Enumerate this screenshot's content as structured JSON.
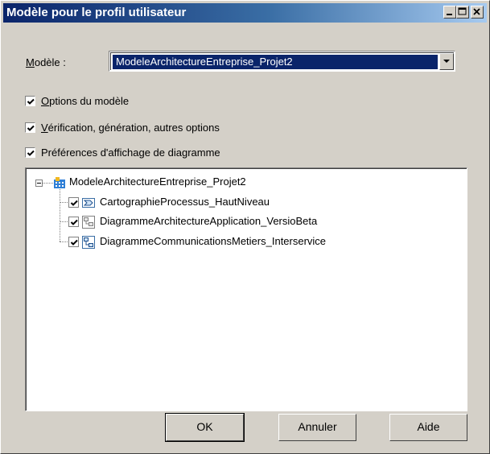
{
  "window": {
    "title": "Modèle pour le profil utilisateur",
    "controls": [
      "minimize-icon",
      "maximize-icon",
      "close-icon"
    ]
  },
  "model": {
    "label_prefix": "M",
    "label_rest": "odèle :",
    "selected_value": "ModeleArchitectureEntreprise_Projet2"
  },
  "options": [
    {
      "underlined": "O",
      "rest": "ptions du modèle",
      "checked": true
    },
    {
      "underlined": "V",
      "rest": "érification, génération, autres options",
      "checked": true
    },
    {
      "underlined": "",
      "rest": "Préférences d'affichage de diagramme",
      "checked": true
    }
  ],
  "tree": {
    "root": {
      "label": "ModeleArchitectureEntreprise_Projet2",
      "icon": "model-building-icon",
      "expanded": true
    },
    "children": [
      {
        "label": "CartographieProcessus_HautNiveau",
        "icon": "process-diagram-icon",
        "checked": true
      },
      {
        "label": "DiagrammeArchitectureApplication_VersioBeta",
        "icon": "application-diagram-icon",
        "checked": true
      },
      {
        "label": "DiagrammeCommunicationsMetiers_Interservice",
        "icon": "communication-diagram-icon",
        "checked": true
      }
    ]
  },
  "buttons": {
    "ok": "OK",
    "cancel": "Annuler",
    "help": "Aide"
  },
  "colors": {
    "titlebar_start": "#0a246a",
    "titlebar_end": "#a6caf0",
    "face": "#d4d0c8",
    "selection": "#0a246a"
  }
}
